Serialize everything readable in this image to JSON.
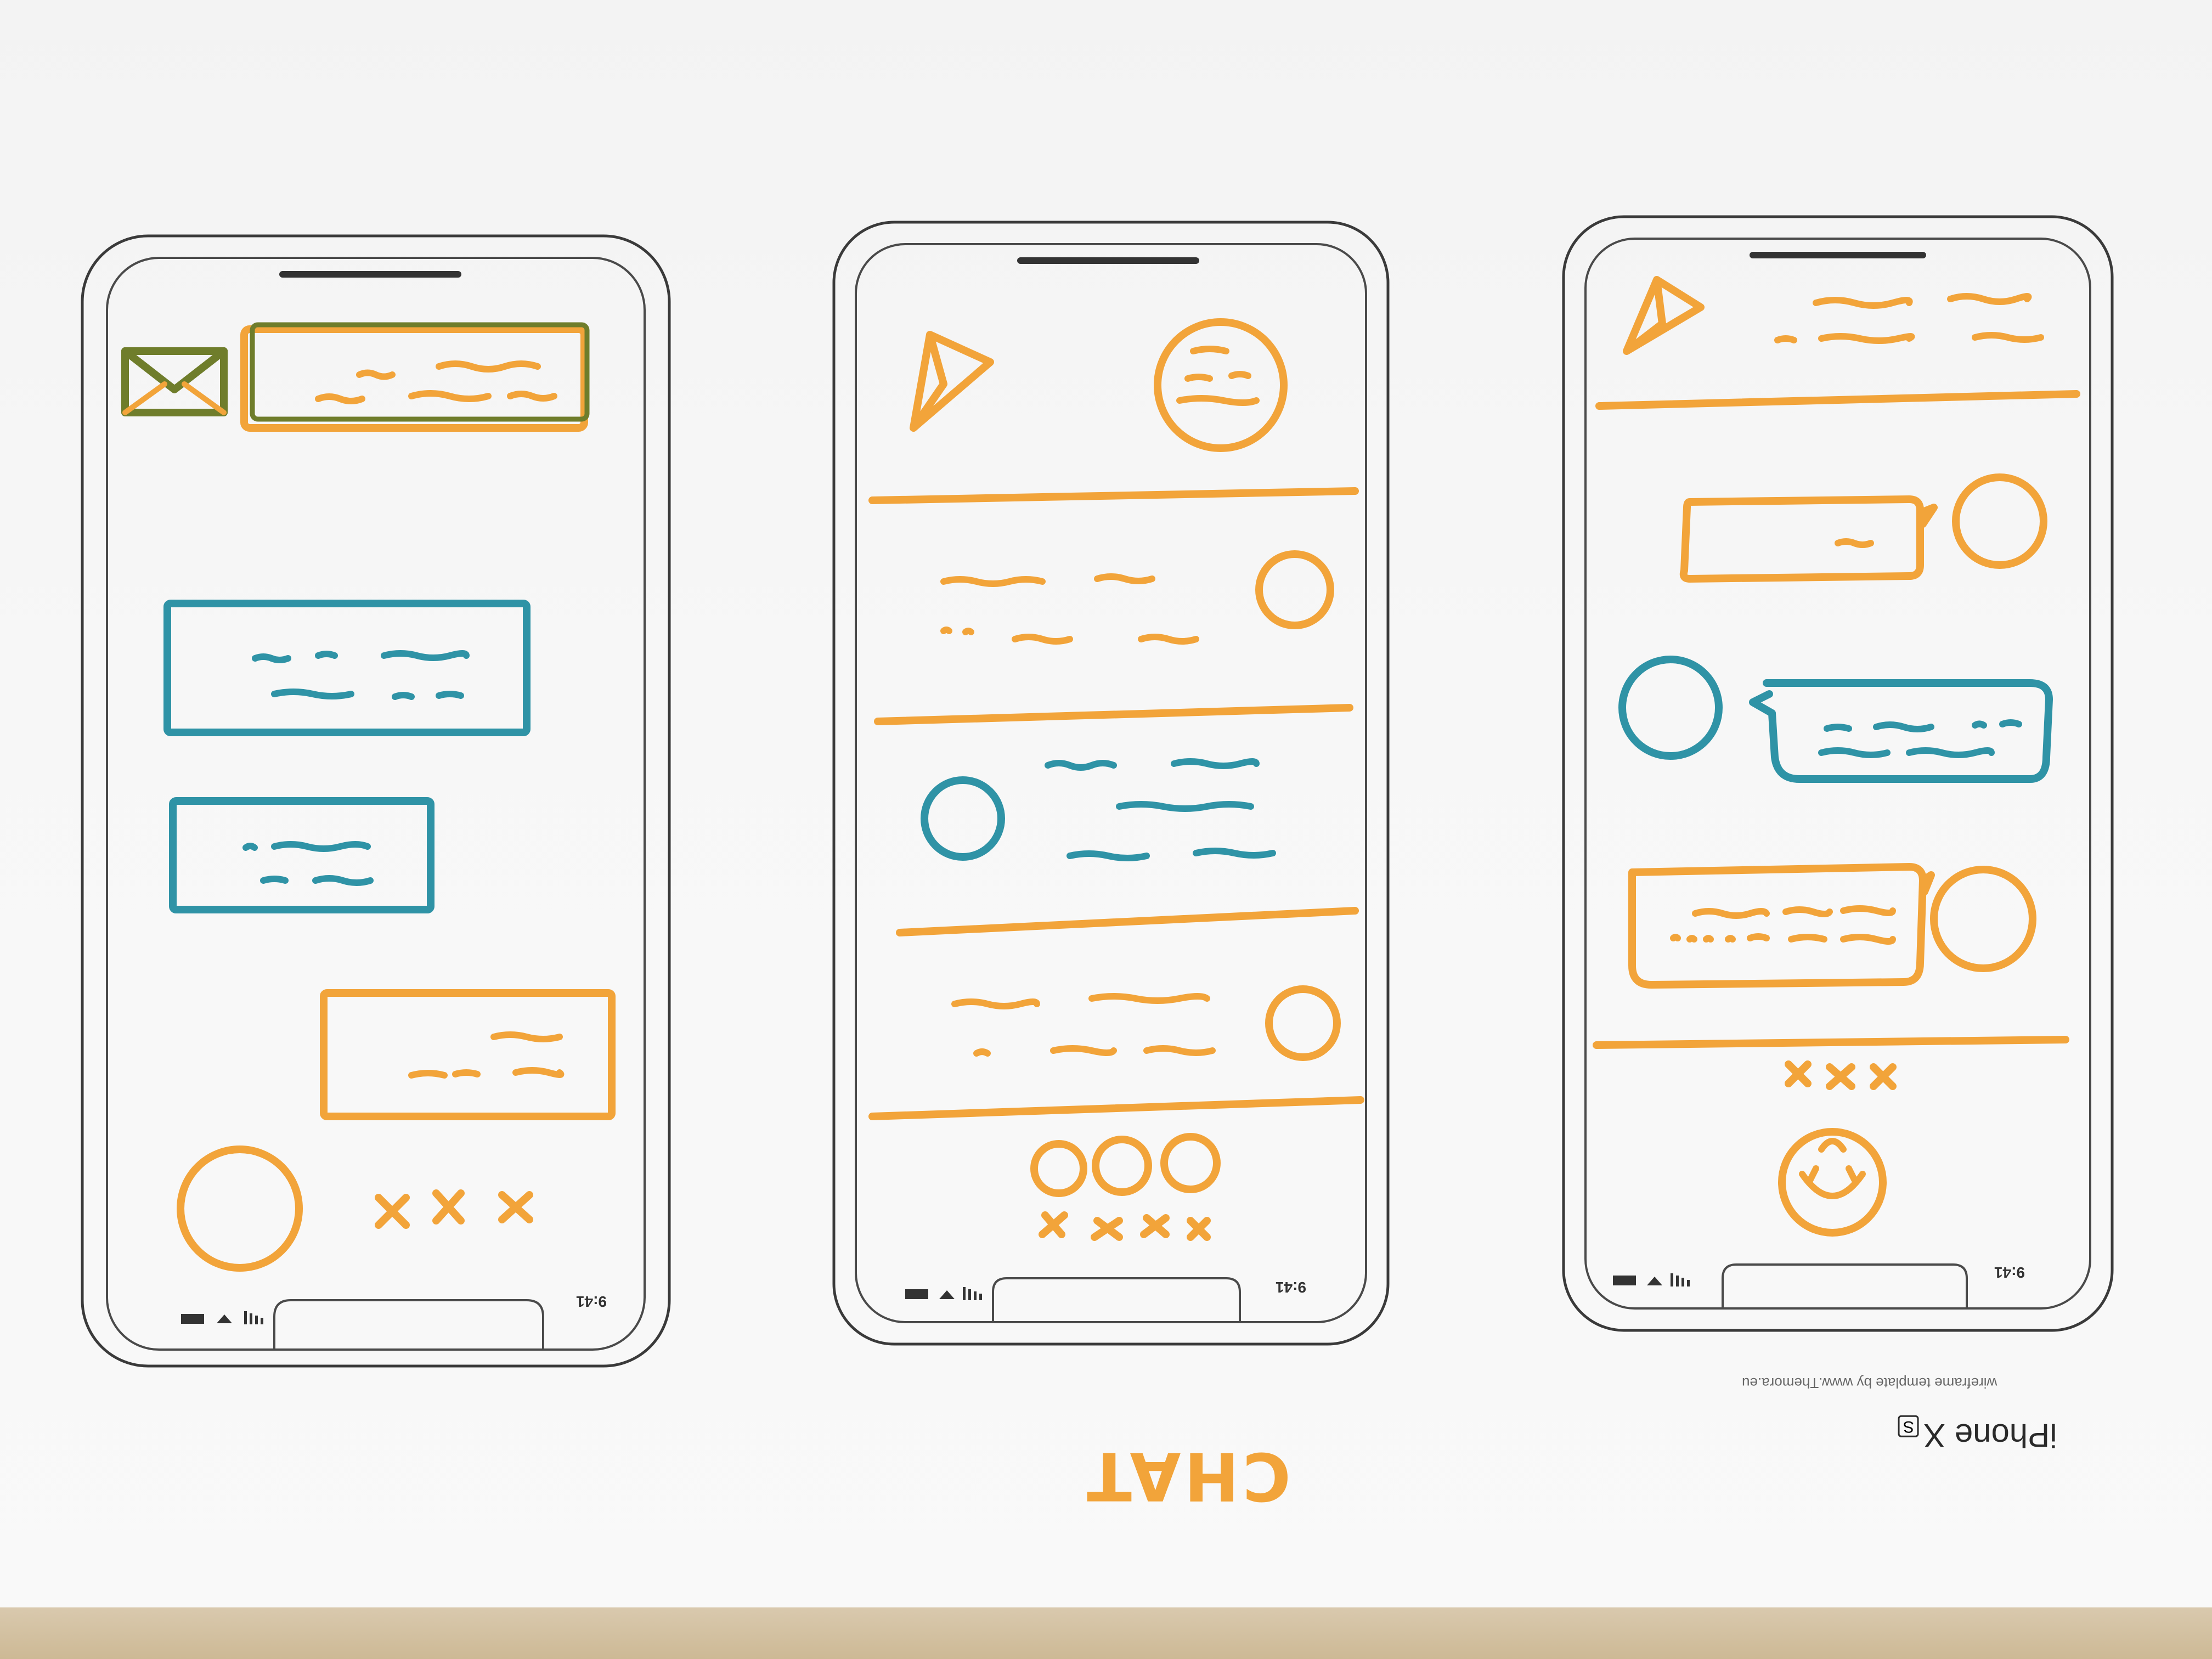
{
  "template": {
    "brand": "iPhone X",
    "brand_badge": "S",
    "credit": "wireframe template by www.Themora.eu",
    "status_time": "9:41"
  },
  "sheet_title": "CHAT",
  "colors": {
    "orange": "#f2a43a",
    "teal": "#2f93a6",
    "olive": "#6f7d2b",
    "outline": "#3a3a3a"
  },
  "icons": [
    "envelope-icon",
    "paper-plane-icon",
    "smiley-face-icon",
    "avatar-circle-icon"
  ]
}
